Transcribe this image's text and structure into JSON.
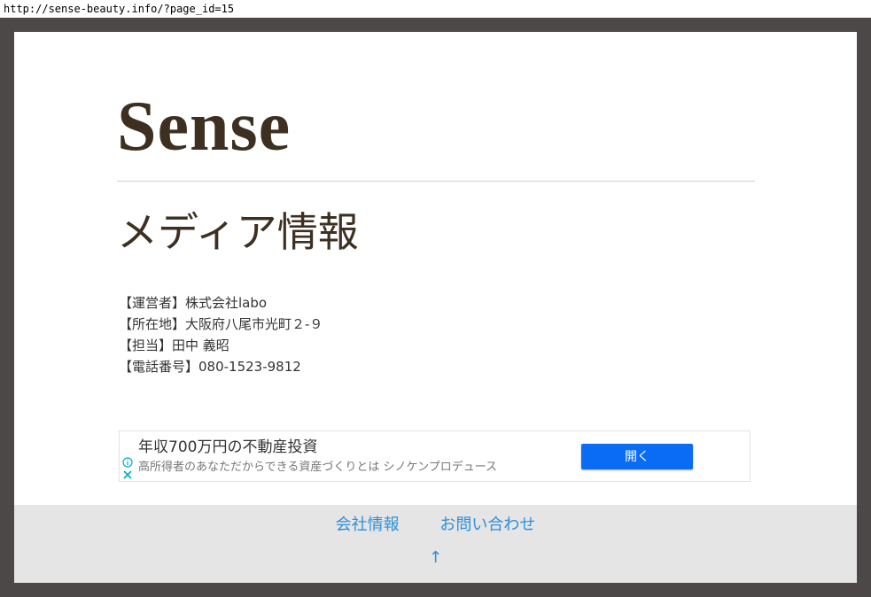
{
  "browser": {
    "url": "http://sense-beauty.info/?page_id=15"
  },
  "site": {
    "title": "Sense"
  },
  "page": {
    "heading": "メディア情報"
  },
  "info": {
    "lines": [
      "【運営者】株式会社labo",
      "【所在地】大阪府八尾市光町２-９",
      "【担当】田中 義昭",
      "【電話番号】080-1523-9812"
    ]
  },
  "ad": {
    "title": "年収700万円の不動産投資",
    "description": "高所得者のあなただからできる資産づくりとは シノケンプロデュース",
    "button_label": "開く",
    "info_icon": "info-icon",
    "close_icon": "close-icon"
  },
  "footer": {
    "links": [
      "会社情報",
      "お問い合わせ"
    ],
    "back_to_top": "↑"
  },
  "colors": {
    "frame": "#4d4848",
    "title": "#3d3021",
    "link": "#2e8fd9",
    "footer_bg": "#e5e5e5",
    "ad_button": "#0a6cf5"
  }
}
